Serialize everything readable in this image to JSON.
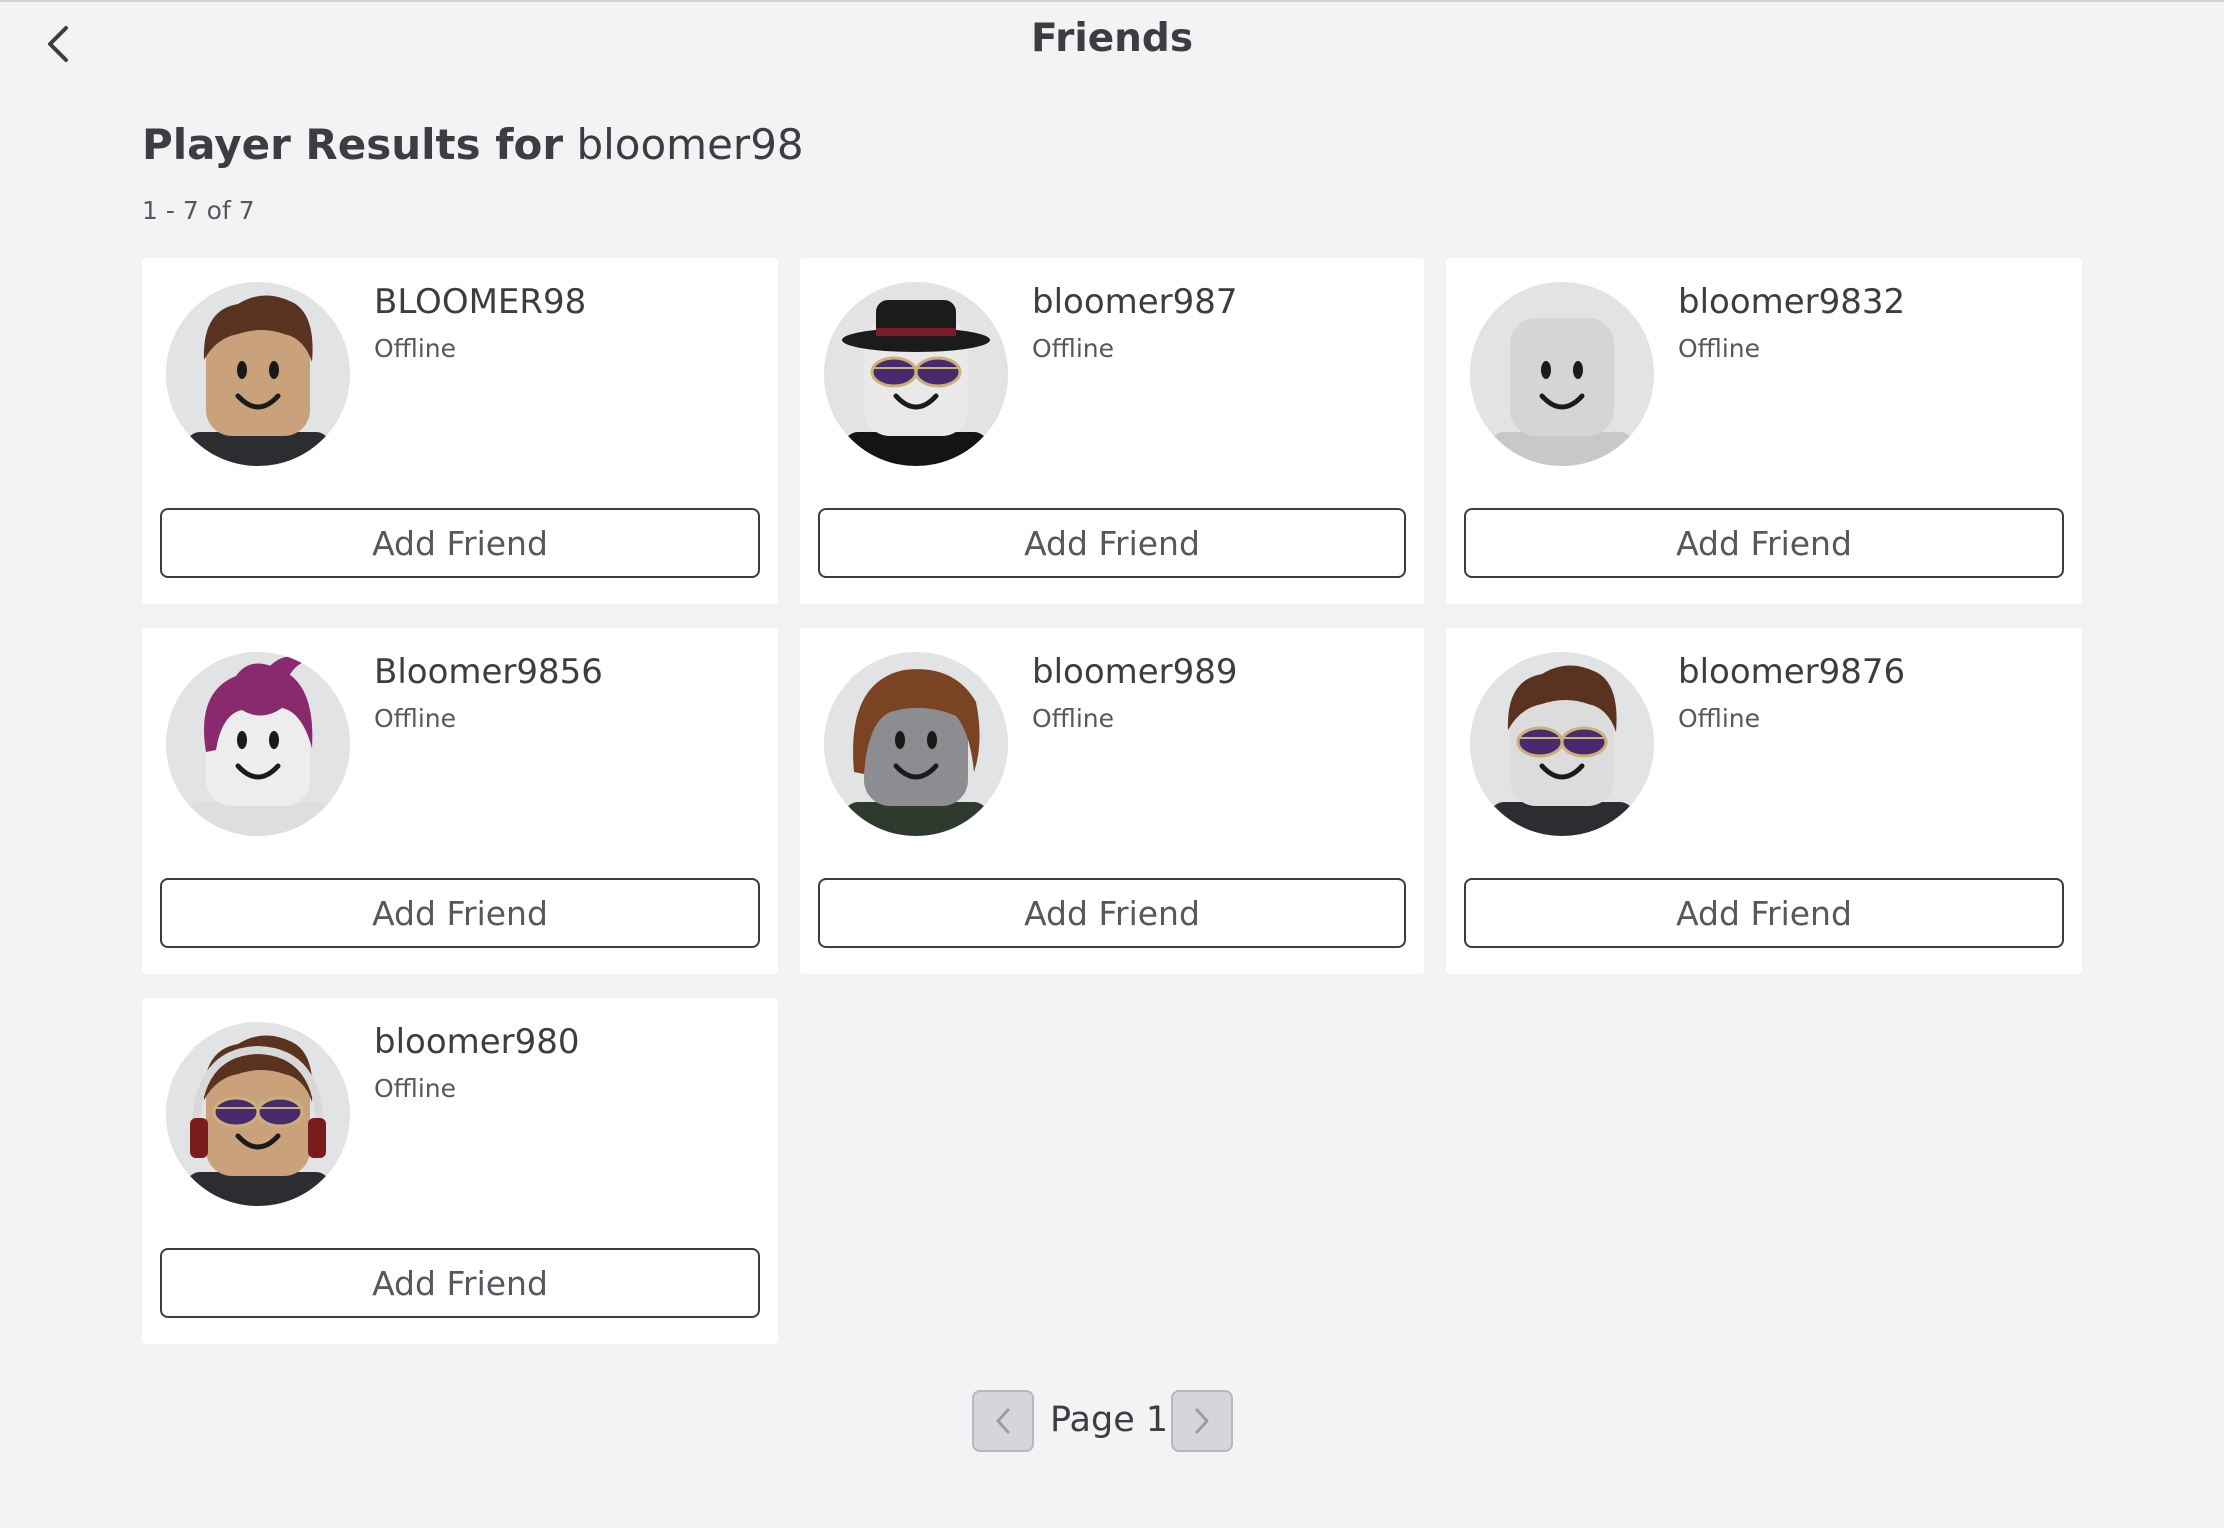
{
  "header": {
    "title": "Friends",
    "back_icon": "chevron-left-icon"
  },
  "results": {
    "heading_prefix": "Player Results for",
    "query": "bloomer98",
    "count_text": "1 - 7 of 7"
  },
  "players": [
    {
      "name": "BLOOMER98",
      "status": "Offline",
      "action": "Add Friend",
      "skin": "#c9a27c",
      "hair": "#5a3220",
      "accessory": "hair",
      "torso": "#2b2d30"
    },
    {
      "name": "bloomer987",
      "status": "Offline",
      "action": "Add Friend",
      "skin": "#e9e9e9",
      "hair": "#1b1b1b",
      "accessory": "fedora-shades",
      "torso": "#141414"
    },
    {
      "name": "bloomer9832",
      "status": "Offline",
      "action": "Add Friend",
      "skin": "#d5d5d5",
      "hair": "",
      "accessory": "none",
      "torso": "#c8c8c8"
    },
    {
      "name": "Bloomer9856",
      "status": "Offline",
      "action": "Add Friend",
      "skin": "#ededed",
      "hair": "#8a2a6e",
      "accessory": "ponytail",
      "torso": "#dedede"
    },
    {
      "name": "bloomer989",
      "status": "Offline",
      "action": "Add Friend",
      "skin": "#8b8d90",
      "hair": "#7a4422",
      "accessory": "long-hair",
      "torso": "#2f3a2f"
    },
    {
      "name": "bloomer9876",
      "status": "Offline",
      "action": "Add Friend",
      "skin": "#dcdcdc",
      "hair": "#5a3220",
      "accessory": "hair-shades",
      "torso": "#2b2d30"
    },
    {
      "name": "bloomer980",
      "status": "Offline",
      "action": "Add Friend",
      "skin": "#c9a27c",
      "hair": "#5a3220",
      "accessory": "headphones-shades",
      "torso": "#2b2d30"
    }
  ],
  "pagination": {
    "label": "Page 1",
    "prev_icon": "chevron-left-icon",
    "next_icon": "chevron-right-icon"
  },
  "colors": {
    "background": "#f2f3f5",
    "card": "#ffffff",
    "text": "#3b3d40",
    "secondary_text": "#55585c"
  }
}
